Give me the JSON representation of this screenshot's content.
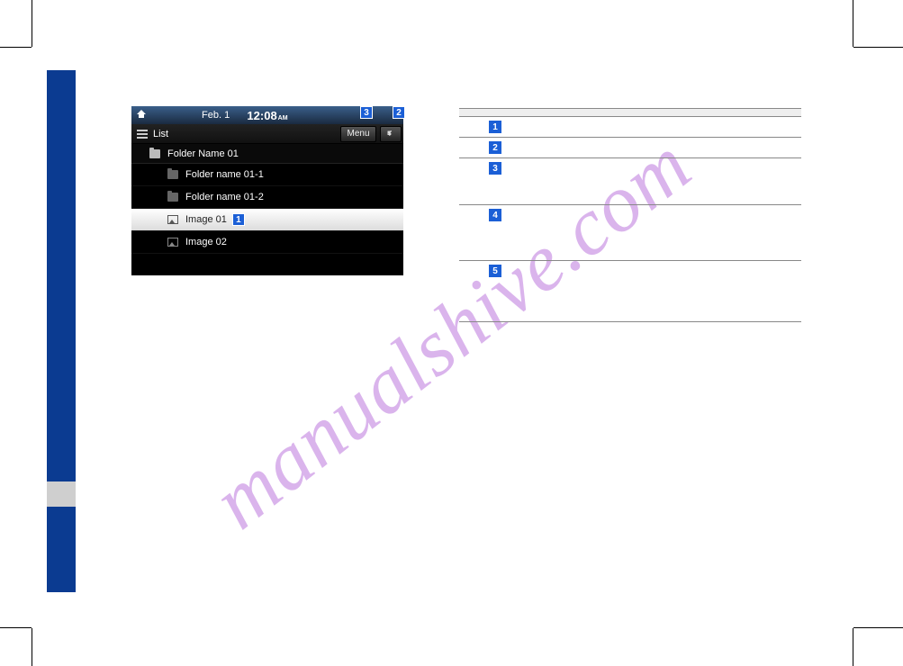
{
  "watermark": "manualshive.com",
  "screenshot": {
    "topbar": {
      "date": "Feb. 1",
      "time": "12:08",
      "ampm": "AM"
    },
    "subbar": {
      "list_label": "List",
      "menu_label": "Menu"
    },
    "header_folder": "Folder Name 01",
    "rows": [
      {
        "type": "folder",
        "label": "Folder name 01-1"
      },
      {
        "type": "folder",
        "label": "Folder name 01-2"
      },
      {
        "type": "image",
        "label": "Image 01",
        "selected": true,
        "callout": "1"
      },
      {
        "type": "image",
        "label": "Image 02"
      }
    ],
    "overlay_callouts": {
      "c3": "3",
      "c2": "2"
    }
  },
  "table": {
    "header": {
      "name": "",
      "description": ""
    },
    "rows": [
      {
        "num": "1",
        "text": ""
      },
      {
        "num": "2",
        "text": ""
      },
      {
        "num": "3",
        "text": ""
      },
      {
        "num": "4",
        "text": ""
      },
      {
        "num": "5",
        "text": ""
      }
    ]
  }
}
